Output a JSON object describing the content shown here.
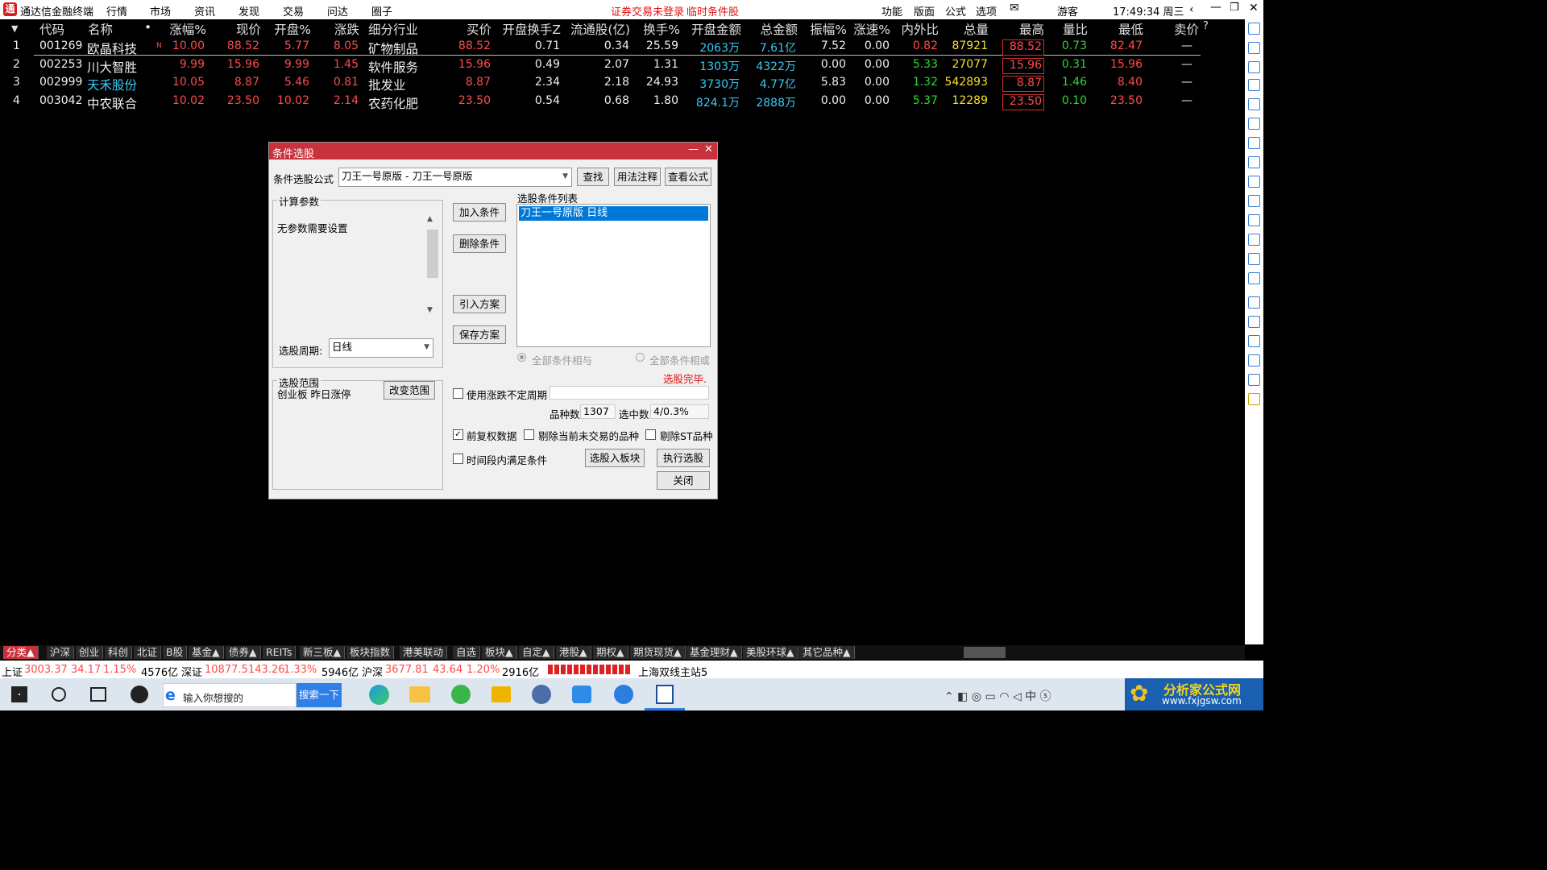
{
  "app": {
    "title": "通达信金融终端",
    "menu": [
      "行情",
      "市场",
      "资讯",
      "发现",
      "交易",
      "问达",
      "圈子"
    ],
    "notice1": "证券交易未登录",
    "notice2": "临时条件股",
    "right_menu": [
      "功能",
      "版面",
      "公式",
      "选项"
    ],
    "user": "游客",
    "clock": "17:49:34 周三"
  },
  "table": {
    "headers": [
      "代码",
      "名称",
      "•",
      "涨幅%",
      "现价",
      "开盘%",
      "涨跌",
      "细分行业",
      "买价",
      "开盘换手Z",
      "流通股(亿)",
      "换手%",
      "开盘金额",
      "总金额",
      "振幅%",
      "涨速%",
      "内外比",
      "总量",
      "最高",
      "量比",
      "最低",
      "卖价",
      "?"
    ],
    "rows": [
      {
        "idx": "1",
        "code": "001269",
        "name": "欧晶科技",
        "flag": "N",
        "chg": "10.00",
        "price": "88.52",
        "open_pct": "5.77",
        "change": "8.05",
        "industry": "矿物制品",
        "bid": "88.52",
        "open_turn": "0.71",
        "float": "0.34",
        "turn": "25.59",
        "open_amt": "2063万",
        "total_amt": "7.61亿",
        "amp": "7.52",
        "speed": "0.00",
        "io": "0.82",
        "vol": "87921",
        "high": "88.52",
        "vr": "0.73",
        "low": "82.47",
        "ask": "—"
      },
      {
        "idx": "2",
        "code": "002253",
        "name": "川大智胜",
        "flag": "",
        "chg": "9.99",
        "price": "15.96",
        "open_pct": "9.99",
        "change": "1.45",
        "industry": "软件服务",
        "bid": "15.96",
        "open_turn": "0.49",
        "float": "2.07",
        "turn": "1.31",
        "open_amt": "1303万",
        "total_amt": "4322万",
        "amp": "0.00",
        "speed": "0.00",
        "io": "5.33",
        "vol": "27077",
        "high": "15.96",
        "vr": "0.31",
        "low": "15.96",
        "ask": "—"
      },
      {
        "idx": "3",
        "code": "002999",
        "name": "天禾股份",
        "flag": "",
        "chg": "10.05",
        "price": "8.87",
        "open_pct": "5.46",
        "change": "0.81",
        "industry": "批发业",
        "bid": "8.87",
        "open_turn": "2.34",
        "float": "2.18",
        "turn": "24.93",
        "open_amt": "3730万",
        "total_amt": "4.77亿",
        "amp": "5.83",
        "speed": "0.00",
        "io": "1.32",
        "vol": "542893",
        "high": "8.87",
        "vr": "1.46",
        "low": "8.40",
        "ask": "—"
      },
      {
        "idx": "4",
        "code": "003042",
        "name": "中农联合",
        "flag": "",
        "chg": "10.02",
        "price": "23.50",
        "open_pct": "10.02",
        "change": "2.14",
        "industry": "农药化肥",
        "bid": "23.50",
        "open_turn": "0.54",
        "float": "0.68",
        "turn": "1.80",
        "open_amt": "824.1万",
        "total_amt": "2888万",
        "amp": "0.00",
        "speed": "0.00",
        "io": "5.37",
        "vol": "12289",
        "high": "23.50",
        "vr": "0.10",
        "low": "23.50",
        "ask": "—"
      }
    ]
  },
  "dialog": {
    "title": "条件选股",
    "formula_label": "条件选股公式",
    "formula_value": "刀王一号原版 - 刀王一号原版",
    "btn_find": "查找",
    "btn_usage": "用法注释",
    "btn_view": "查看公式",
    "params_group": "计算参数",
    "params_text": "无参数需要设置",
    "period_label": "选股周期:",
    "period_value": "日线",
    "btn_add": "加入条件",
    "btn_delete": "删除条件",
    "btn_import": "引入方案",
    "btn_save": "保存方案",
    "list_label": "选股条件列表",
    "list_item": "刀王一号原版  日线",
    "radio_and": "全部条件相与",
    "radio_or": "全部条件相或",
    "status": "选股完毕.",
    "range_group": "选股范围",
    "range_text": "创业板 昨日涨停",
    "btn_range": "改变范围",
    "chk_period": "使用涨跌不定周期",
    "count_label": "品种数",
    "count_value": "1307",
    "selected_label": "选中数",
    "selected_value": "4/0.3%",
    "chk_adjust": "前复权数据",
    "chk_notrade": "剔除当前未交易的品种",
    "chk_st": "剔除ST品种",
    "chk_time": "时间段内满足条件",
    "btn_toblock": "选股入板块",
    "btn_run": "执行选股",
    "btn_close": "关闭"
  },
  "tabs": [
    "分类▲",
    "沪深",
    "创业",
    "科创",
    "北证",
    "B股",
    "基金▲",
    "债券▲",
    "REITs",
    "新三板▲",
    "板块指数",
    "港美联动",
    "自选",
    "板块▲",
    "自定▲",
    "港股▲",
    "期权▲",
    "期货现货▲",
    "基金理财▲",
    "美股环球▲",
    "其它品种▲"
  ],
  "status": {
    "sh_label": "上证",
    "sh_val": "3003.37",
    "sh_chg": "34.17",
    "sh_pct": "1.15%",
    "sh_amt": "4576亿",
    "sz_label": "深证",
    "sz_val": "10877.5",
    "sz_chg": "143.26",
    "sz_pct": "1.33%",
    "sz_amt": "5946亿",
    "hs_label": "沪深",
    "hs_val": "3677.81",
    "hs_chg": "43.64",
    "hs_pct": "1.20%",
    "hs_amt": "2916亿",
    "server": "上海双线主站5"
  },
  "taskbar": {
    "search_placeholder": "输入你想搜的",
    "search_btn": "搜索一下",
    "watermark1": "分析家公式网",
    "watermark2": "www.fxjgsw.com"
  }
}
